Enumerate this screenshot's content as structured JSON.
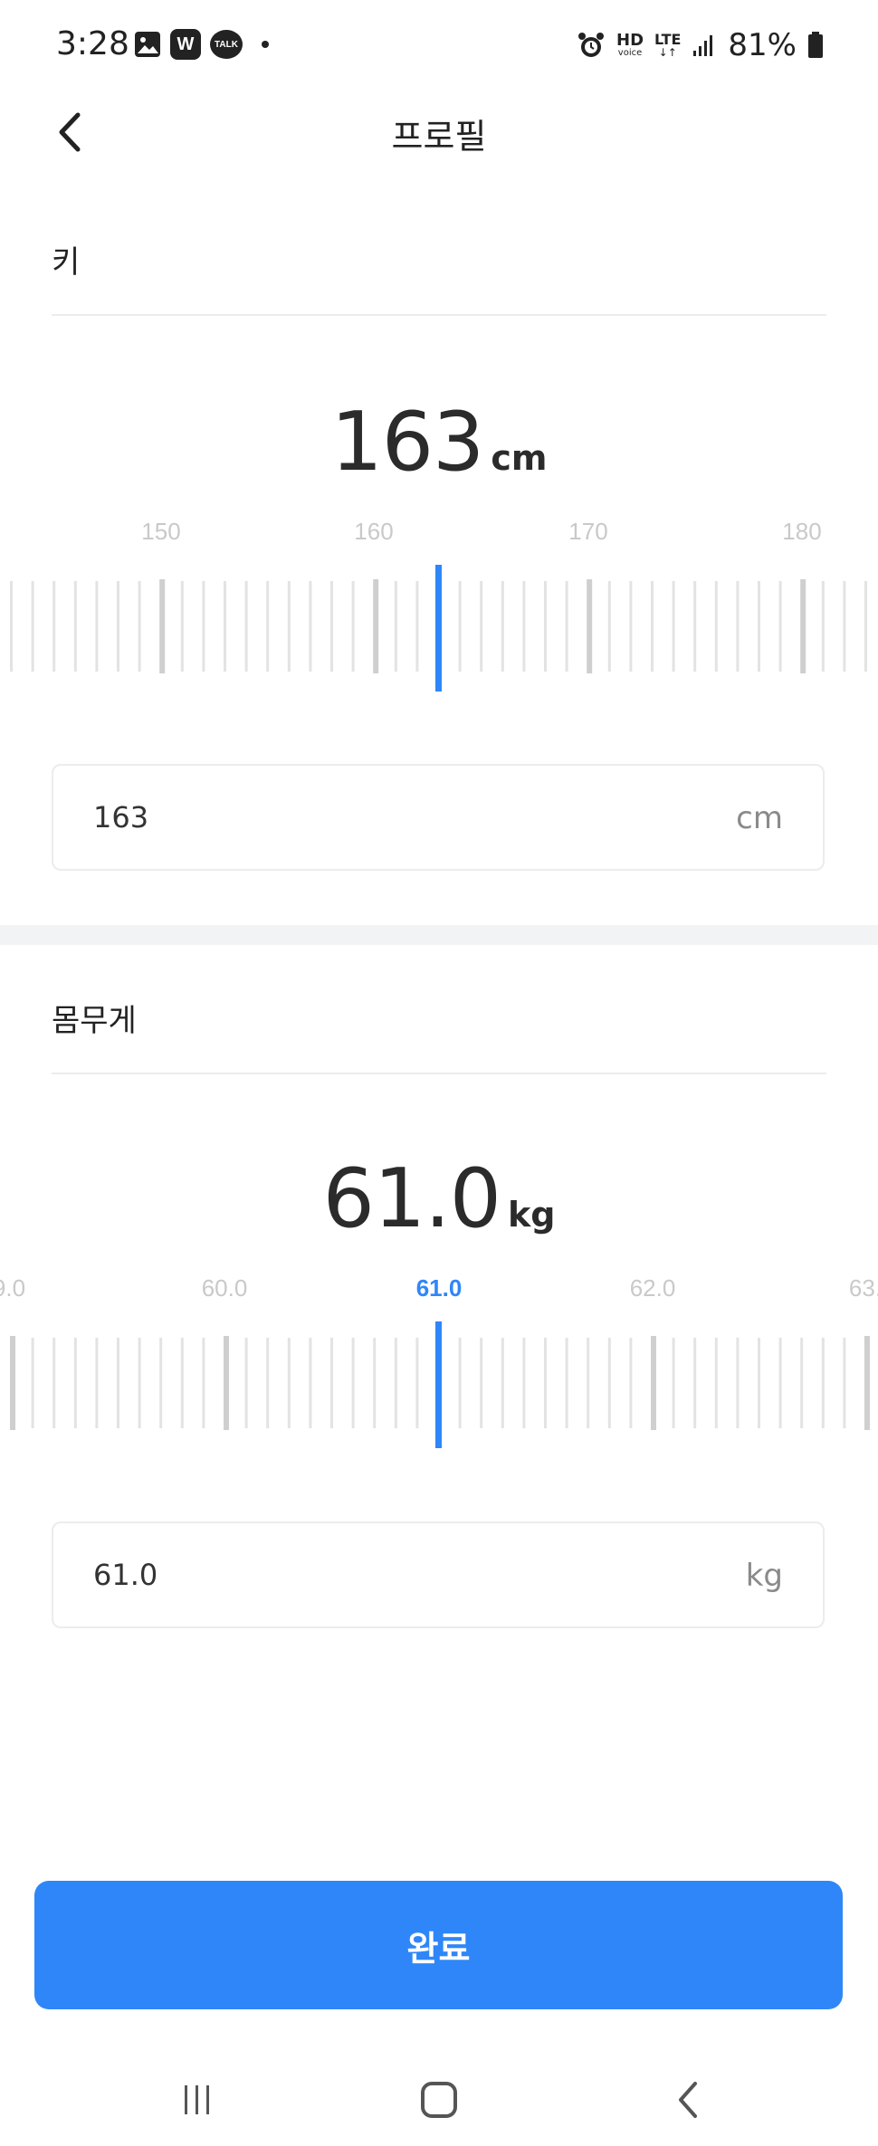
{
  "status_bar": {
    "time": "3:28",
    "battery": "81%",
    "hd_label": "HD",
    "voice_label": "voice",
    "lte_label": "LTE",
    "talk_label": "TALK",
    "w_label": "W"
  },
  "header": {
    "title": "프로필"
  },
  "height": {
    "label": "키",
    "value": "163",
    "unit": "cm",
    "ruler_labels": [
      "150",
      "160",
      "170",
      "180"
    ],
    "ruler_min": 145,
    "ruler_max": 185,
    "selected": 163
  },
  "weight": {
    "label": "몸무게",
    "value": "61.0",
    "unit": "kg",
    "ruler_labels": [
      "9.0",
      "60.0",
      "61.0",
      "62.0",
      "63."
    ],
    "selected_label_index": 2,
    "selected": 61.0
  },
  "done_button": {
    "label": "완료"
  },
  "colors": {
    "accent": "#2f86f8",
    "tick": "#e3e3e3",
    "tick_major": "#cfcfcf",
    "label_gray": "#c9c9c9"
  }
}
